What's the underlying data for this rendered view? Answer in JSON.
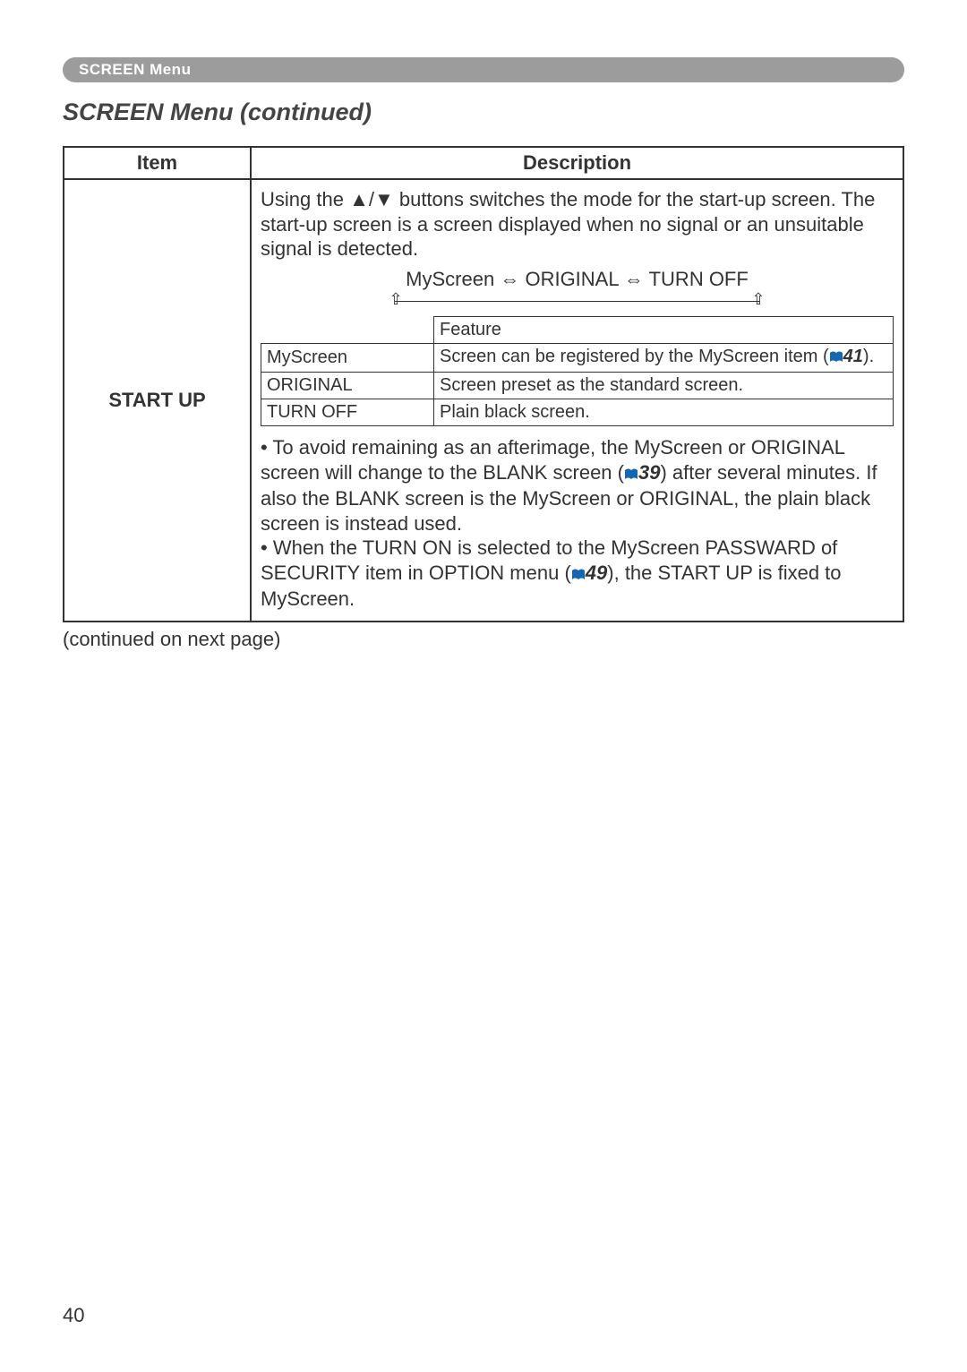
{
  "banner": "SCREEN Menu",
  "section_title": "SCREEN Menu (continued)",
  "columns": {
    "item": "Item",
    "description": "Description"
  },
  "item_name": "START UP",
  "intro_before": "Using the ",
  "intro_arrows": "▲/▼",
  "intro_after": " buttons switches the mode for the start-up screen. The start-up screen is a screen displayed when no signal or an unsuitable signal is detected.",
  "cycle": {
    "a": "MyScreen",
    "b": "ORIGINAL",
    "c": "TURN OFF",
    "sep": " ⇔ "
  },
  "inner": {
    "feature_header": "Feature",
    "rows": [
      {
        "name": "MyScreen",
        "feature_before": "Screen can be registered by the MyScreen item (",
        "ref": "41",
        "feature_after": ")."
      },
      {
        "name": "ORIGINAL",
        "feature_plain": "Screen preset as the standard screen."
      },
      {
        "name": "TURN OFF",
        "feature_plain": "Plain black screen."
      }
    ]
  },
  "note1_before": "• To avoid remaining as an afterimage, the MyScreen or ORIGINAL screen will change to the BLANK screen (",
  "note1_ref": "39",
  "note1_after": ") after several minutes. If also the BLANK screen is the MyScreen or ORIGINAL, the plain black screen is instead used.",
  "note2_before": "• When the TURN ON is selected to the MyScreen PASSWARD of SECURITY item in OPTION menu (",
  "note2_ref": "49",
  "note2_after": "), the START UP is fixed to MyScreen.",
  "continued": "(continued on next page)",
  "page_number": "40"
}
